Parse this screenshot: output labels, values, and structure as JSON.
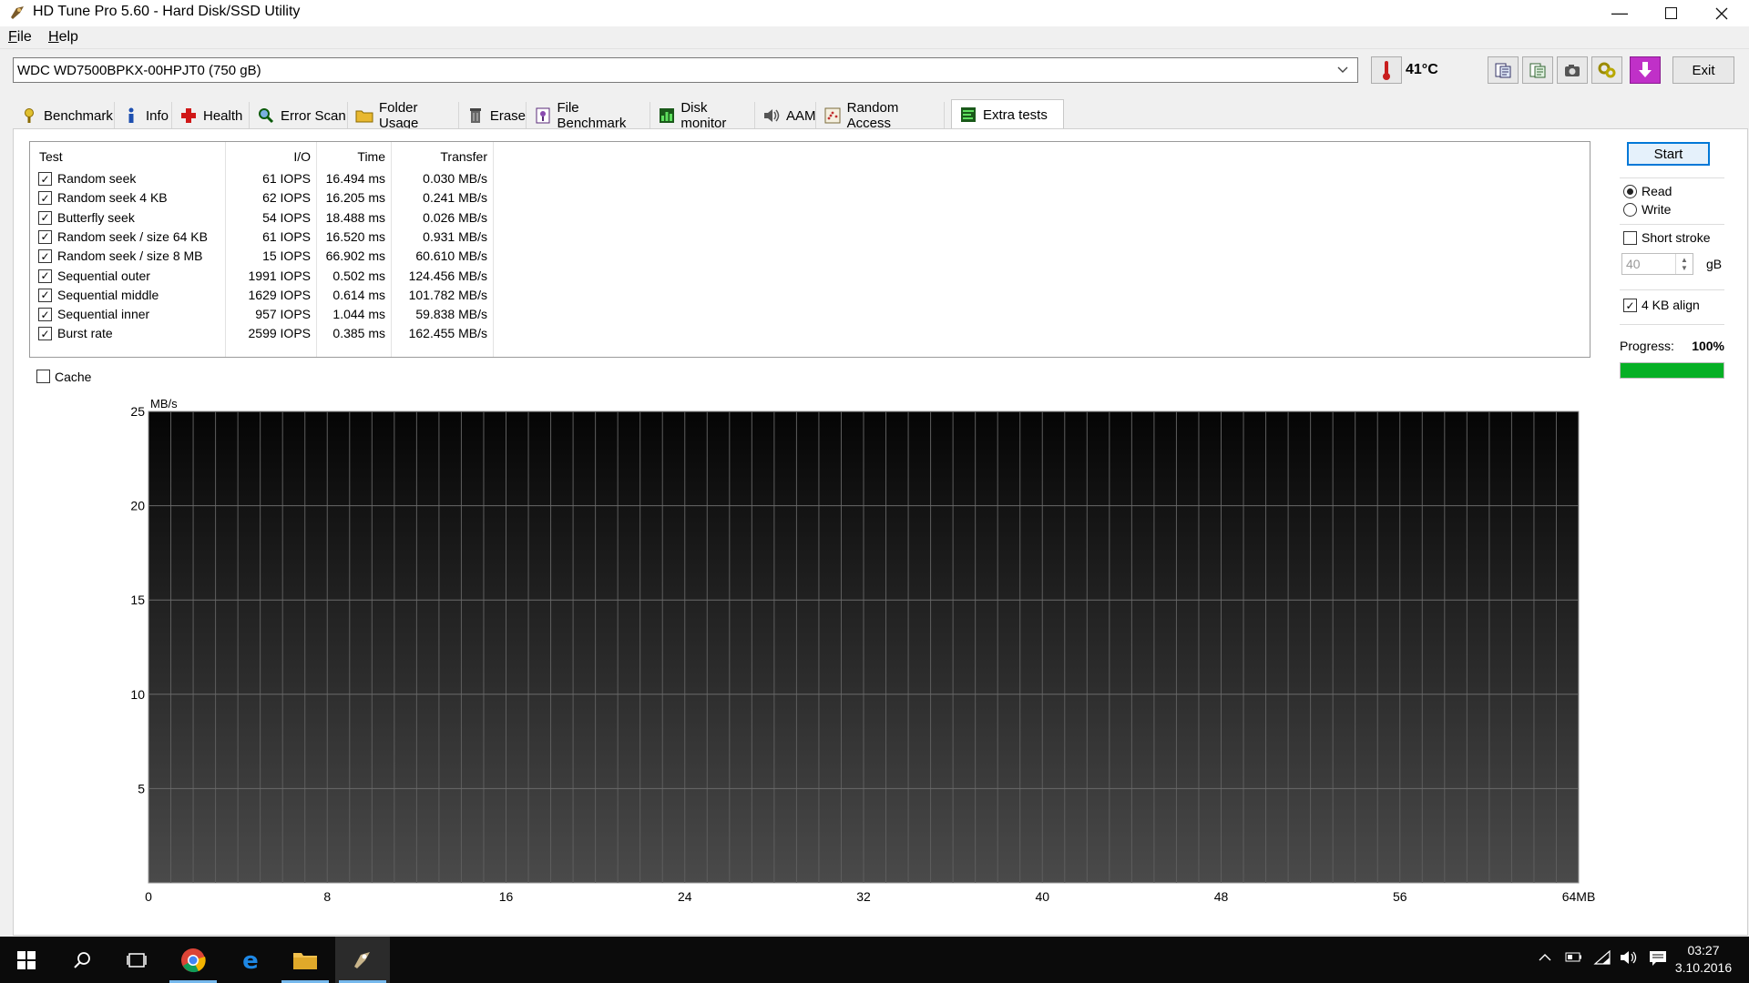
{
  "window": {
    "title": "HD Tune Pro 5.60 - Hard Disk/SSD Utility",
    "controls": [
      "minimize",
      "maximize",
      "close"
    ]
  },
  "menu": {
    "file_u": "F",
    "file_rest": "ile",
    "help_u": "H",
    "help_rest": "elp"
  },
  "toolbar": {
    "drive": "WDC WD7500BPKX-00HPJT0 (750 gB)",
    "temperature": "41°C",
    "exit_label": "Exit",
    "icons": [
      "thermometer-icon",
      "copy-info-icon",
      "copy-all-icon",
      "screenshot-icon",
      "options-icon",
      "download-icon"
    ]
  },
  "tabs": [
    {
      "label": "Benchmark",
      "icon": "benchmark-icon"
    },
    {
      "label": "Info",
      "icon": "info-icon"
    },
    {
      "label": "Health",
      "icon": "health-icon"
    },
    {
      "label": "Error Scan",
      "icon": "error-scan-icon"
    },
    {
      "label": "Folder Usage",
      "icon": "folder-usage-icon"
    },
    {
      "label": "Erase",
      "icon": "erase-icon"
    },
    {
      "label": "File Benchmark",
      "icon": "file-benchmark-icon"
    },
    {
      "label": "Disk monitor",
      "icon": "disk-monitor-icon"
    },
    {
      "label": "AAM",
      "icon": "aam-icon"
    },
    {
      "label": "Random Access",
      "icon": "random-access-icon"
    },
    {
      "label": "Extra tests",
      "icon": "extra-tests-icon",
      "active": true
    }
  ],
  "results": {
    "headers": {
      "test": "Test",
      "io": "I/O",
      "time": "Time",
      "transfer": "Transfer"
    },
    "rows": [
      {
        "test": "Random seek",
        "io": "61 IOPS",
        "time": "16.494 ms",
        "transfer": "0.030 MB/s",
        "checked": true
      },
      {
        "test": "Random seek 4 KB",
        "io": "62 IOPS",
        "time": "16.205 ms",
        "transfer": "0.241 MB/s",
        "checked": true
      },
      {
        "test": "Butterfly seek",
        "io": "54 IOPS",
        "time": "18.488 ms",
        "transfer": "0.026 MB/s",
        "checked": true
      },
      {
        "test": "Random seek / size 64 KB",
        "io": "61 IOPS",
        "time": "16.520 ms",
        "transfer": "0.931 MB/s",
        "checked": true
      },
      {
        "test": "Random seek / size 8 MB",
        "io": "15 IOPS",
        "time": "66.902 ms",
        "transfer": "60.610 MB/s",
        "checked": true
      },
      {
        "test": "Sequential outer",
        "io": "1991 IOPS",
        "time": "0.502 ms",
        "transfer": "124.456 MB/s",
        "checked": true
      },
      {
        "test": "Sequential middle",
        "io": "1629 IOPS",
        "time": "0.614 ms",
        "transfer": "101.782 MB/s",
        "checked": true
      },
      {
        "test": "Sequential inner",
        "io": "957 IOPS",
        "time": "1.044 ms",
        "transfer": "59.838 MB/s",
        "checked": true
      },
      {
        "test": "Burst rate",
        "io": "2599 IOPS",
        "time": "0.385 ms",
        "transfer": "162.455 MB/s",
        "checked": true
      }
    ]
  },
  "cache_label": "Cache",
  "cache_checked": false,
  "side": {
    "start_label": "Start",
    "read_label": "Read",
    "read_selected": true,
    "write_label": "Write",
    "short_stroke_label": "Short stroke",
    "short_stroke_checked": false,
    "short_stroke_value": "40",
    "unit": "gB",
    "align_label": "4 KB align",
    "align_checked": true,
    "progress_label": "Progress:",
    "progress_text": "100%",
    "progress_value": 1.0
  },
  "chart_data": {
    "type": "line",
    "ylabel": "MB/s",
    "ylim": [
      0,
      25
    ],
    "yticks": [
      "25",
      "20",
      "15",
      "10",
      "5"
    ],
    "xlim": [
      0,
      64
    ],
    "xticks": [
      "0",
      "8",
      "16",
      "24",
      "32",
      "40",
      "48",
      "56",
      "64MB"
    ],
    "grid": true,
    "series": []
  },
  "taskbar": {
    "apps": [
      {
        "name": "chrome",
        "running": true
      },
      {
        "name": "edge",
        "running": false
      },
      {
        "name": "file-explorer",
        "running": true
      },
      {
        "name": "hd-tune",
        "running": true,
        "active": true
      }
    ],
    "time": "03:27",
    "date": "3.10.2016"
  }
}
